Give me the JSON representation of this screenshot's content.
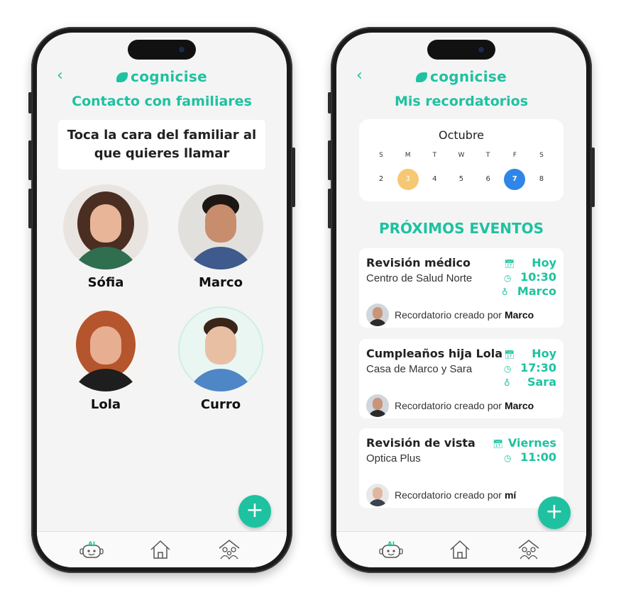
{
  "brand": {
    "name": "cognicise",
    "accent": "#1ec2a0"
  },
  "left": {
    "back_icon": "chevron-left-icon",
    "title": "Contacto con familiares",
    "prompt_line1": "Toca la cara del familiar al",
    "prompt_line2": "que quieres llamar",
    "contacts": [
      {
        "name": "Sófia"
      },
      {
        "name": "Marco"
      },
      {
        "name": "Lola"
      },
      {
        "name": "Curro"
      }
    ],
    "fab_label": "+"
  },
  "right": {
    "back_icon": "chevron-left-icon",
    "title": "Mis recordatorios",
    "calendar": {
      "month": "Octubre",
      "weekdays": [
        "S",
        "M",
        "T",
        "W",
        "T",
        "F",
        "S"
      ],
      "dates": [
        "2",
        "3",
        "4",
        "5",
        "6",
        "7",
        "8"
      ],
      "today": "3",
      "selected": "7",
      "today_color": "#f7c873",
      "selected_color": "#2f86e8"
    },
    "section_title": "PRÓXIMOS EVENTOS",
    "events": [
      {
        "title": "Revisión médico",
        "place": "Centro de Salud Norte",
        "day": "Hoy",
        "time": "10:30",
        "with": "Marco",
        "creator_prefix": "Recordatorio creado por",
        "creator": "Marco"
      },
      {
        "title": "Cumpleaños hija Lola",
        "place": "Casa de Marco y Sara",
        "day": "Hoy",
        "time": "17:30",
        "with": "Sara",
        "creator_prefix": "Recordatorio creado por",
        "creator": "Marco"
      },
      {
        "title": "Revisión de vista",
        "place": "Optica Plus",
        "day": "Viernes",
        "time": "11:00",
        "creator_prefix": "Recordatorio creado por",
        "creator": "mí"
      }
    ],
    "fab_label": "+"
  },
  "tabbar": {
    "ai_label": "AI",
    "tabs": [
      "robot-ai-icon",
      "home-icon",
      "family-house-icon"
    ]
  }
}
